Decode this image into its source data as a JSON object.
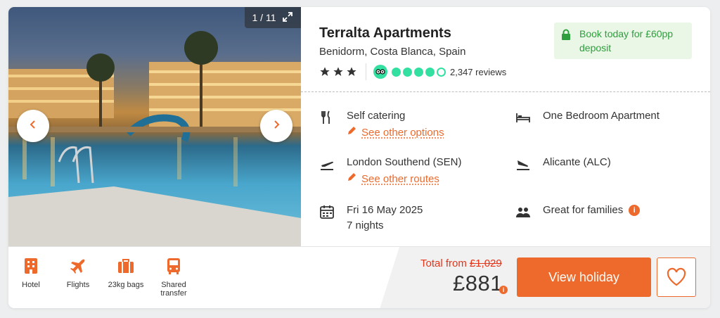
{
  "hotel": {
    "name": "Terralta Apartments",
    "location": "Benidorm, Costa Blanca, Spain",
    "star_rating": 3,
    "tripadvisor_rating": 4.5,
    "reviews": "2,347 reviews"
  },
  "gallery": {
    "counter_current": "1",
    "counter_sep": "/",
    "counter_total": "11"
  },
  "deposit": {
    "text": "Book today for £60pp deposit"
  },
  "features": {
    "board": "Self catering",
    "board_link": "See other options",
    "room": "One Bedroom Apartment",
    "departure": "London Southend (SEN)",
    "departure_link": "See other routes",
    "arrival": "Alicante (ALC)",
    "date": "Fri 16 May 2025",
    "nights": "7 nights",
    "family": "Great for families",
    "info_icon": "i"
  },
  "included": [
    {
      "label": "Hotel",
      "icon": "hotel-icon"
    },
    {
      "label": "Flights",
      "icon": "plane-icon"
    },
    {
      "label": "23kg bags",
      "icon": "luggage-icon"
    },
    {
      "label": "Shared transfer",
      "icon": "bus-icon"
    }
  ],
  "pricing": {
    "total_label": "Total from",
    "old_price": "£1,029",
    "price": "£881",
    "cta": "View holiday"
  },
  "colors": {
    "accent": "#ed6a2c",
    "price_red": "#e3361b",
    "deposit_green": "#2e9e3e",
    "tripadvisor": "#34e0a1"
  }
}
